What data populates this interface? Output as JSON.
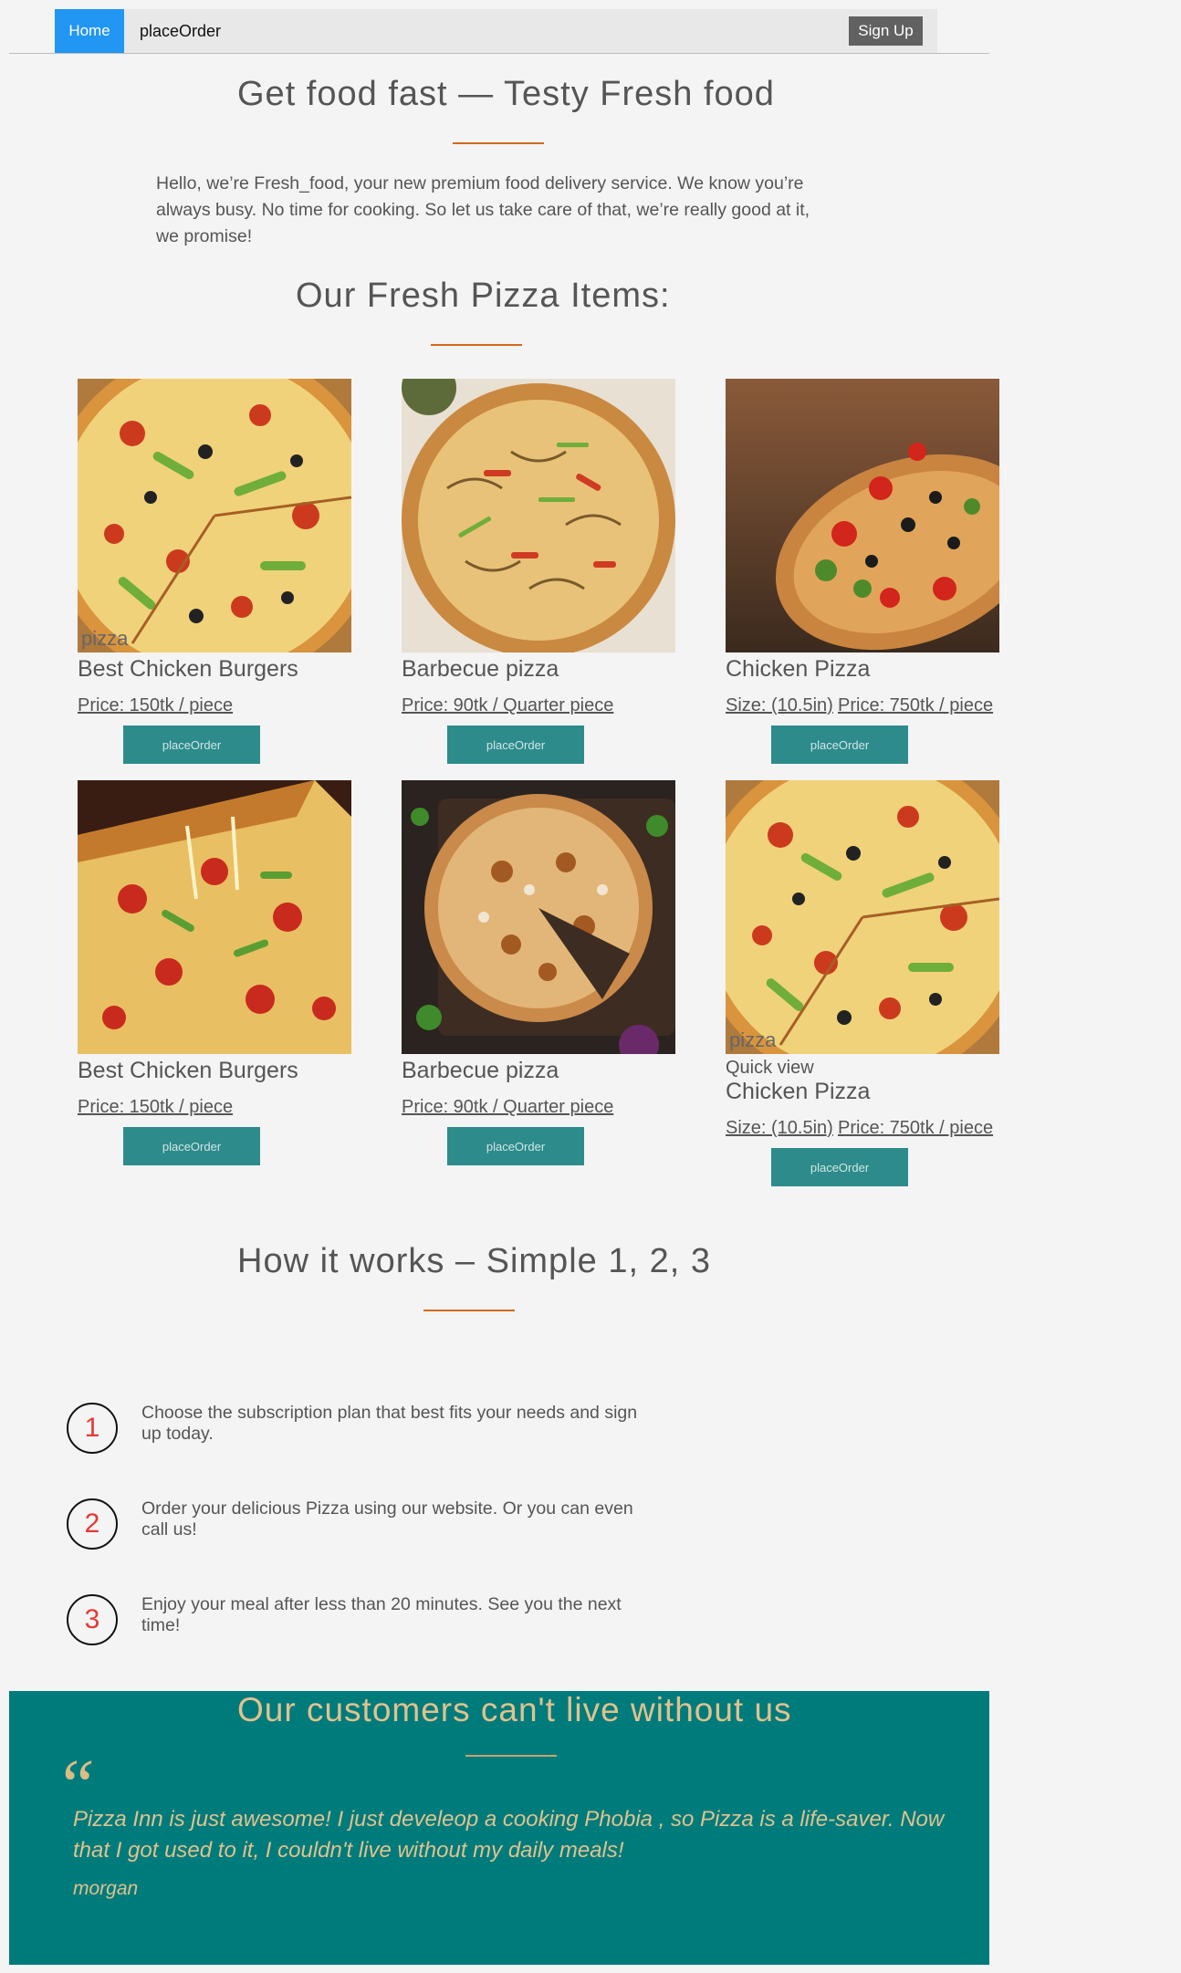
{
  "nav": {
    "home": "Home",
    "link": "placeOrder",
    "signup": "Sign Up"
  },
  "hero": {
    "title": "Get food fast — Testy Fresh food",
    "intro": "Hello, we’re Fresh_food, your new premium food delivery service. We know you’re always busy. No time for cooking. So let us take care of that, we’re really good at it, we promise!"
  },
  "menu": {
    "title": "Our Fresh Pizza Items:",
    "button_label": "placeOrder",
    "items": [
      {
        "image_caption": "pizza",
        "title": "Best Chicken Burgers",
        "price": "Price: 150tk / piece"
      },
      {
        "title": "Barbecue pizza",
        "price": "Price: 90tk / Quarter piece"
      },
      {
        "size": "Size: (10.5in)",
        "price": "Price: 750tk / piece",
        "title": "Chicken Pizza"
      },
      {
        "title": "Best Chicken Burgers",
        "price": "Price: 150tk / piece"
      },
      {
        "title": "Barbecue pizza",
        "price": "Price: 90tk / Quarter piece"
      },
      {
        "image_caption": "pizza",
        "quick_view": "Quick view",
        "title": "Chicken Pizza",
        "size": "Size: (10.5in)",
        "price": "Price: 750tk / piece"
      }
    ]
  },
  "how": {
    "title": "How it works – Simple 1, 2, 3",
    "steps": [
      {
        "num": "1",
        "text": "Choose the subscription plan that best fits your needs and sign up today."
      },
      {
        "num": "2",
        "text": "Order your delicious Pizza using our website. Or you can even call us!"
      },
      {
        "num": "3",
        "text": "Enjoy your meal after less than 20 minutes. See you the next time!"
      }
    ]
  },
  "testimonials": {
    "title": "Our customers can't live without us",
    "quote_mark": "“",
    "text": "Pizza Inn is just awesome! I just develeop a cooking Phobia , so Pizza is a life-saver. Now that I got used to it, I couldn't live without my daily meals!",
    "author": "morgan"
  },
  "colors": {
    "primary": "#2196f3",
    "accent": "#d2691e",
    "teal": "#007b7b",
    "button": "#2e8b8b"
  }
}
